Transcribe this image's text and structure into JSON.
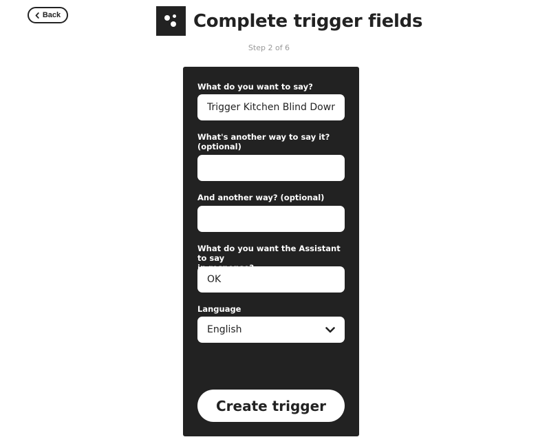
{
  "nav": {
    "back_label": "Back"
  },
  "header": {
    "title": "Complete trigger fields",
    "step": "Step 2 of 6",
    "service_icon": "google-assistant-icon"
  },
  "form": {
    "phrase": {
      "label": "What do you want to say?",
      "value": "Trigger Kitchen Blind Down"
    },
    "alt_phrase_1": {
      "label_line1": "What's another way to say it?",
      "label_line2": "(optional)",
      "value": ""
    },
    "alt_phrase_2": {
      "label": "And another way? (optional)",
      "value": ""
    },
    "response": {
      "label_line1": "What do you want the Assistant to say",
      "label_line2": "in response?",
      "value": "OK"
    },
    "language": {
      "label": "Language",
      "selected": "English"
    },
    "submit_label": "Create trigger"
  },
  "colors": {
    "card_bg": "#222222",
    "text": "#222222",
    "muted": "#999999",
    "background": "#ffffff"
  }
}
